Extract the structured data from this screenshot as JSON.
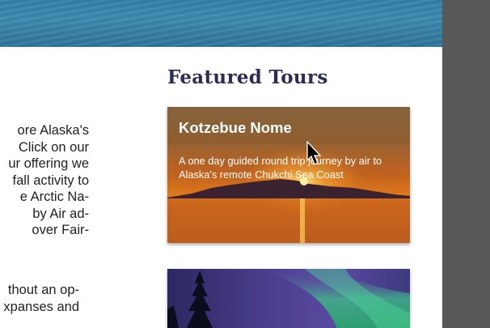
{
  "intro": {
    "lines": [
      "ore Alaska's",
      " Click on our",
      "ur offering we",
      "fall activity to",
      "e Arctic Na-",
      " by Air ad-",
      "over Fair-"
    ]
  },
  "intro2": {
    "lines": [
      "thout an op-",
      "xpanses and"
    ]
  },
  "featured": {
    "heading": "Featured Tours",
    "tours": [
      {
        "title": "Kotzebue Nome",
        "description": "A one day guided round trip journey by air to Alaska's remote Chukchi Sea Coast"
      }
    ]
  },
  "colors": {
    "heading": "#2b2d55",
    "sidebar_bg": "#585858"
  }
}
